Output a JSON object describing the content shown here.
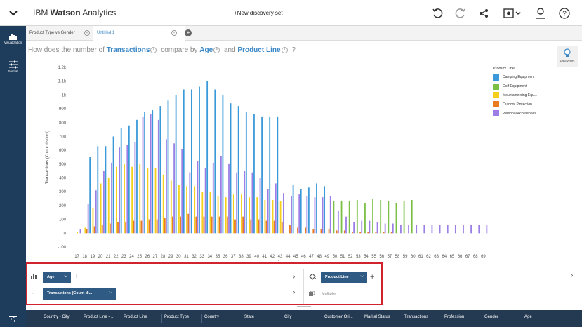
{
  "app": {
    "brand_prefix": "IBM ",
    "brand_bold": "Watson",
    "brand_suffix": " Analytics",
    "discovery_title": "+New discovery set",
    "menu_icon": "chevron-down-icon"
  },
  "sidebar": {
    "items": [
      {
        "label": "Visualization",
        "icon": "bar-chart-icon"
      },
      {
        "label": "Format",
        "icon": "sliders-icon"
      }
    ]
  },
  "tabs": [
    {
      "label": "Product Type vs Gender",
      "active": false
    },
    {
      "label": "Untitled 1",
      "active": true
    }
  ],
  "question": {
    "prefix": "How does the number of",
    "metric": "Transactions",
    "mid": "compare by",
    "dim1": "Age",
    "and": "and",
    "dim2": "Product Line",
    "suffix": "?"
  },
  "discover_label": "Discoveries",
  "legend": {
    "title": "Product Line",
    "items": [
      {
        "name": "Camping Equipment",
        "color": "#3a9ad9"
      },
      {
        "name": "Golf Equipment",
        "color": "#7bbf44"
      },
      {
        "name": "Mountaineering Equ...",
        "color": "#f4cf1c"
      },
      {
        "name": "Outdoor Protection",
        "color": "#e87c1e"
      },
      {
        "name": "Personal Accessories",
        "color": "#9b7fe6"
      }
    ]
  },
  "chart_data": {
    "type": "bar",
    "ylabel": "Transactions (Count distinct)",
    "xlabel": "Age",
    "ylim": [
      -100,
      1200
    ],
    "yticks": [
      "-100",
      "0",
      "100",
      "200",
      "300",
      "400",
      "500",
      "600",
      "700",
      "800",
      "900",
      "1k",
      "1.1k",
      "1.2k"
    ],
    "categories": [
      "17",
      "18",
      "19",
      "20",
      "21",
      "22",
      "23",
      "24",
      "25",
      "26",
      "27",
      "28",
      "29",
      "30",
      "31",
      "32",
      "33",
      "34",
      "35",
      "36",
      "37",
      "38",
      "39",
      "40",
      "41",
      "42",
      "43",
      "44",
      "45",
      "46",
      "47",
      "48",
      "49",
      "50",
      "51",
      "52",
      "53",
      "54",
      "55",
      "56",
      "57",
      "58",
      "59",
      "60",
      "61",
      "62",
      "63",
      "64",
      "65",
      "66",
      "67",
      "68",
      "69"
    ],
    "series": [
      {
        "name": "Camping Equipment",
        "values": [
          0,
          0,
          550,
          630,
          630,
          700,
          760,
          780,
          820,
          880,
          890,
          920,
          960,
          1000,
          1040,
          1040,
          1060,
          1100,
          1040,
          1000,
          940,
          920,
          880,
          860,
          840,
          840,
          840,
          0,
          350,
          320,
          330,
          360,
          340,
          0,
          0,
          0,
          0,
          0,
          0,
          0,
          0,
          0,
          0,
          0,
          0,
          0,
          0,
          0,
          0,
          0,
          0,
          0,
          0
        ]
      },
      {
        "name": "Golf Equipment",
        "values": [
          0,
          0,
          0,
          0,
          0,
          0,
          0,
          0,
          0,
          0,
          0,
          0,
          0,
          0,
          0,
          0,
          0,
          0,
          0,
          0,
          0,
          0,
          0,
          0,
          0,
          0,
          0,
          0,
          0,
          0,
          0,
          0,
          0,
          230,
          230,
          230,
          240,
          220,
          250,
          240,
          230,
          220,
          230,
          240,
          0,
          0,
          0,
          0,
          0,
          0,
          0,
          0,
          0
        ]
      },
      {
        "name": "Mountaineering Equ...",
        "values": [
          10,
          40,
          180,
          360,
          400,
          480,
          500,
          480,
          500,
          470,
          470,
          420,
          380,
          350,
          340,
          340,
          300,
          300,
          270,
          260,
          280,
          280,
          260,
          260,
          240,
          240,
          230,
          0,
          0,
          0,
          0,
          0,
          0,
          0,
          0,
          0,
          0,
          0,
          0,
          0,
          0,
          0,
          0,
          0,
          0,
          0,
          0,
          0,
          0,
          0,
          0,
          0,
          0
        ]
      },
      {
        "name": "Outdoor Protection",
        "values": [
          0,
          30,
          50,
          60,
          70,
          80,
          80,
          90,
          90,
          100,
          100,
          110,
          120,
          120,
          140,
          120,
          120,
          120,
          120,
          120,
          100,
          120,
          100,
          100,
          90,
          90,
          80,
          60,
          40,
          40,
          30,
          30,
          30,
          20,
          20,
          10,
          10,
          10,
          10,
          10,
          10,
          0,
          0,
          0,
          0,
          0,
          0,
          0,
          0,
          0,
          0,
          0,
          0
        ]
      },
      {
        "name": "Personal Accessories",
        "values": [
          30,
          210,
          310,
          450,
          510,
          620,
          640,
          660,
          840,
          860,
          820,
          680,
          650,
          610,
          440,
          520,
          470,
          510,
          560,
          500,
          440,
          450,
          440,
          400,
          320,
          360,
          290,
          270,
          280,
          270,
          260,
          260,
          270,
          160,
          120,
          80,
          90,
          90,
          80,
          70,
          70,
          60,
          60,
          60,
          60,
          60,
          60,
          60,
          60,
          60,
          60,
          60,
          60
        ]
      }
    ]
  },
  "controls": {
    "row1_dim": "Age",
    "row1_right_dim": "Product Line",
    "row2_measure": "Transactions (Count di...",
    "multiplier_label": "Multiplier"
  },
  "columns": [
    "Country - City",
    "Product Line - ...",
    "Product Line",
    "Product Type",
    "Country",
    "State",
    "City",
    "Customer Ori...",
    "Marital Status",
    "Transactions",
    "Profession",
    "Gender",
    "Age"
  ]
}
